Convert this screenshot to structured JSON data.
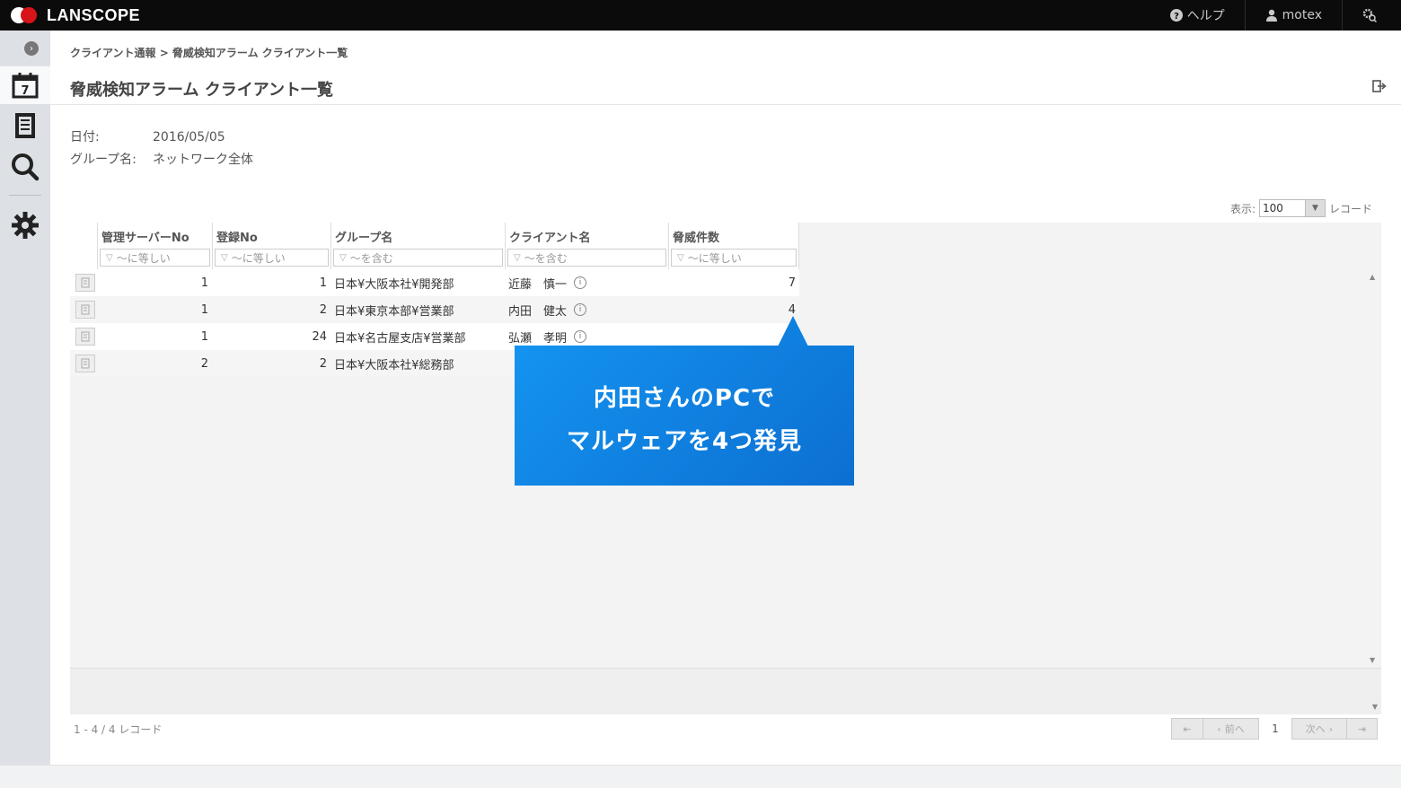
{
  "app": {
    "logo_text": "LANSCOPE",
    "nav": {
      "help_label": "ヘルプ",
      "user_label": "motex"
    }
  },
  "breadcrumb": "クライアント通報 > 脅威検知アラーム クライアント一覧",
  "page_title": "脅威検知アラーム クライアント一覧",
  "meta": {
    "date_label": "日付:",
    "date_value": "2016/05/05",
    "group_label": "グループ名:",
    "group_value": "ネットワーク全体"
  },
  "display": {
    "label": "表示:",
    "value": "100",
    "suffix": "レコード"
  },
  "table": {
    "columns": [
      {
        "header": "管理サーバーNo",
        "filter": "～に等しい"
      },
      {
        "header": "登録No",
        "filter": "～に等しい"
      },
      {
        "header": "グループ名",
        "filter": "～を含む"
      },
      {
        "header": "クライアント名",
        "filter": "～を含む"
      },
      {
        "header": "脅威件数",
        "filter": "～に等しい"
      }
    ],
    "rows": [
      {
        "server_no": "1",
        "reg_no": "1",
        "group": "日本¥大阪本社¥開発部",
        "client": "近藤　慎一",
        "threats": "7"
      },
      {
        "server_no": "1",
        "reg_no": "2",
        "group": "日本¥東京本部¥営業部",
        "client": "内田　健太",
        "threats": "4"
      },
      {
        "server_no": "1",
        "reg_no": "24",
        "group": "日本¥名古屋支店¥営業部",
        "client": "弘瀬　孝明",
        "threats": ""
      },
      {
        "server_no": "2",
        "reg_no": "2",
        "group": "日本¥大阪本社¥総務部",
        "client": "",
        "threats": ""
      }
    ]
  },
  "record_count": "1 - 4 / 4 レコード",
  "pager": {
    "prev_label": "前へ",
    "page": "1",
    "next_label": "次へ"
  },
  "callout": {
    "line1": "内田さんのPCで",
    "line2": "マルウェアを4つ発見"
  },
  "colors": {
    "topbar": "#0b0b0b",
    "logo_red": "#d7141a",
    "callout": "#0f80e0"
  }
}
